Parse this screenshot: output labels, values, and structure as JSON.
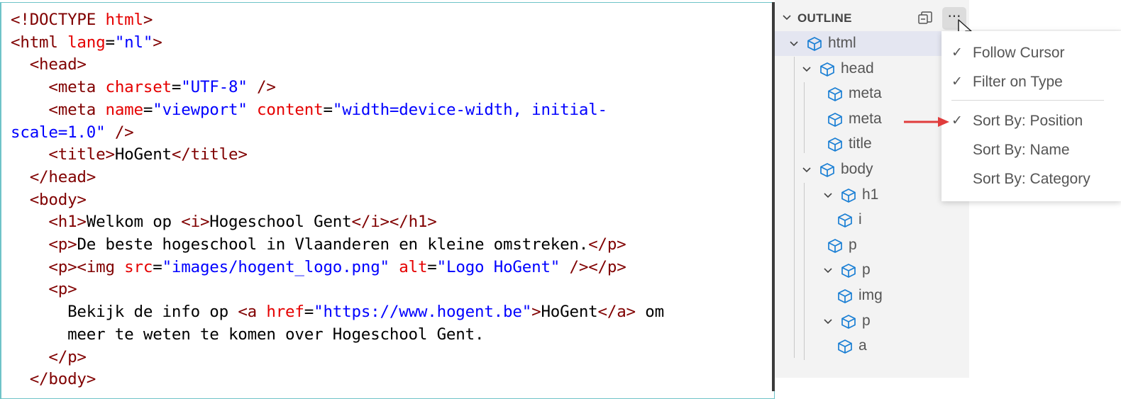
{
  "editor": {
    "lines": [
      [
        {
          "t": "tag",
          "v": "<!DOCTYPE "
        },
        {
          "t": "attr",
          "v": "html"
        },
        {
          "t": "tag",
          "v": ">"
        }
      ],
      [
        {
          "t": "tag",
          "v": "<html "
        },
        {
          "t": "attr",
          "v": "lang"
        },
        {
          "t": "txt",
          "v": "="
        },
        {
          "t": "val",
          "v": "\"nl\""
        },
        {
          "t": "tag",
          "v": ">"
        }
      ],
      [
        {
          "t": "txt",
          "v": "  "
        },
        {
          "t": "tag",
          "v": "<head>"
        }
      ],
      [
        {
          "t": "txt",
          "v": "    "
        },
        {
          "t": "tag",
          "v": "<meta "
        },
        {
          "t": "attr",
          "v": "charset"
        },
        {
          "t": "txt",
          "v": "="
        },
        {
          "t": "val",
          "v": "\"UTF-8\""
        },
        {
          "t": "tag",
          "v": " />"
        }
      ],
      [
        {
          "t": "txt",
          "v": "    "
        },
        {
          "t": "tag",
          "v": "<meta "
        },
        {
          "t": "attr",
          "v": "name"
        },
        {
          "t": "txt",
          "v": "="
        },
        {
          "t": "val",
          "v": "\"viewport\""
        },
        {
          "t": "txt",
          "v": " "
        },
        {
          "t": "attr",
          "v": "content"
        },
        {
          "t": "txt",
          "v": "="
        },
        {
          "t": "val",
          "v": "\"width=device-width, initial-"
        }
      ],
      [
        {
          "t": "val",
          "v": "scale=1.0\""
        },
        {
          "t": "tag",
          "v": " />"
        }
      ],
      [
        {
          "t": "txt",
          "v": "    "
        },
        {
          "t": "tag",
          "v": "<title>"
        },
        {
          "t": "txt",
          "v": "HoGent"
        },
        {
          "t": "tag",
          "v": "</title>"
        }
      ],
      [
        {
          "t": "txt",
          "v": "  "
        },
        {
          "t": "tag",
          "v": "</head>"
        }
      ],
      [
        {
          "t": "txt",
          "v": "  "
        },
        {
          "t": "tag",
          "v": "<body>"
        }
      ],
      [
        {
          "t": "txt",
          "v": "    "
        },
        {
          "t": "tag",
          "v": "<h1>"
        },
        {
          "t": "txt",
          "v": "Welkom op "
        },
        {
          "t": "tag",
          "v": "<i>"
        },
        {
          "t": "txt",
          "v": "Hogeschool Gent"
        },
        {
          "t": "tag",
          "v": "</i></h1>"
        }
      ],
      [
        {
          "t": "txt",
          "v": "    "
        },
        {
          "t": "tag",
          "v": "<p>"
        },
        {
          "t": "txt",
          "v": "De beste hogeschool in Vlaanderen en kleine omstreken."
        },
        {
          "t": "tag",
          "v": "</p>"
        }
      ],
      [
        {
          "t": "txt",
          "v": "    "
        },
        {
          "t": "tag",
          "v": "<p><img "
        },
        {
          "t": "attr",
          "v": "src"
        },
        {
          "t": "txt",
          "v": "="
        },
        {
          "t": "val",
          "v": "\"images/hogent_logo.png\""
        },
        {
          "t": "txt",
          "v": " "
        },
        {
          "t": "attr",
          "v": "alt"
        },
        {
          "t": "txt",
          "v": "="
        },
        {
          "t": "val",
          "v": "\"Logo HoGent\""
        },
        {
          "t": "tag",
          "v": " /></p>"
        }
      ],
      [
        {
          "t": "txt",
          "v": "    "
        },
        {
          "t": "tag",
          "v": "<p>"
        }
      ],
      [
        {
          "t": "txt",
          "v": "      Bekijk de info op "
        },
        {
          "t": "tag",
          "v": "<a "
        },
        {
          "t": "attr",
          "v": "href"
        },
        {
          "t": "txt",
          "v": "="
        },
        {
          "t": "val",
          "v": "\"https://www.hogent.be\""
        },
        {
          "t": "tag",
          "v": ">"
        },
        {
          "t": "txt",
          "v": "HoGent"
        },
        {
          "t": "tag",
          "v": "</a>"
        },
        {
          "t": "txt",
          "v": " om"
        }
      ],
      [
        {
          "t": "txt",
          "v": "      meer te weten te komen over Hogeschool Gent."
        }
      ],
      [
        {
          "t": "txt",
          "v": "    "
        },
        {
          "t": "tag",
          "v": "</p>"
        }
      ],
      [
        {
          "t": "txt",
          "v": "  "
        },
        {
          "t": "tag",
          "v": "</body>"
        }
      ]
    ]
  },
  "outline": {
    "title": "OUTLINE",
    "more_label": "···",
    "items": [
      {
        "label": "html",
        "depth": 0,
        "expanded": true,
        "selected": true
      },
      {
        "label": "head",
        "depth": 1,
        "expanded": true
      },
      {
        "label": "meta",
        "depth": 2
      },
      {
        "label": "meta",
        "depth": 2
      },
      {
        "label": "title",
        "depth": 2
      },
      {
        "label": "body",
        "depth": 1,
        "expanded": true
      },
      {
        "label": "h1",
        "depth": 2,
        "expanded": true
      },
      {
        "label": "i",
        "depth": 3
      },
      {
        "label": "p",
        "depth": 2
      },
      {
        "label": "p",
        "depth": 2,
        "expanded": true
      },
      {
        "label": "img",
        "depth": 3
      },
      {
        "label": "p",
        "depth": 2,
        "expanded": true
      },
      {
        "label": "a",
        "depth": 3
      }
    ]
  },
  "menu": {
    "items": [
      {
        "label": "Follow Cursor",
        "checked": true
      },
      {
        "label": "Filter on Type",
        "checked": true
      },
      {
        "label": "Sort By: Position",
        "checked": true
      },
      {
        "label": "Sort By: Name",
        "checked": false
      },
      {
        "label": "Sort By: Category",
        "checked": false
      }
    ],
    "check_glyph": "✓"
  },
  "colors": {
    "tag": "#800000",
    "attribute": "#e50000",
    "value": "#0000ff",
    "text": "#000000",
    "panel_bg": "#f3f3f3",
    "selection": "#e4e6f1",
    "arrow": "#e03c3c"
  }
}
